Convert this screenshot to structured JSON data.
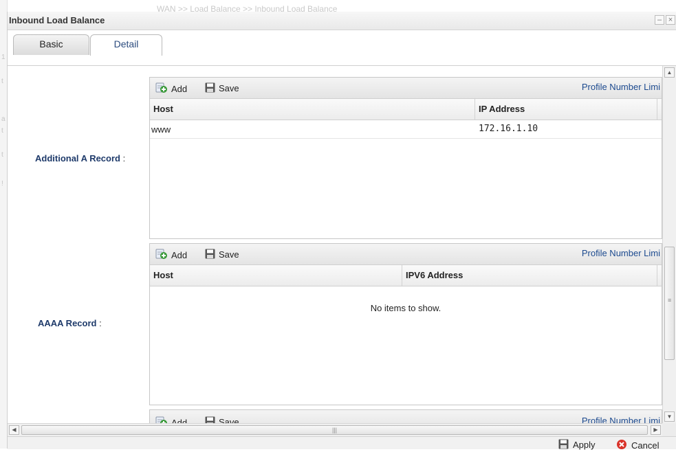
{
  "background": {
    "breadcrumb": "WAN >> Load Balance >> Inbound Load Balance"
  },
  "window": {
    "title": "Inbound Load Balance",
    "minimize_glyph": "–",
    "close_glyph": "×"
  },
  "tabs": [
    {
      "label": "Basic",
      "active": false
    },
    {
      "label": "Detail",
      "active": true
    }
  ],
  "sections": {
    "a_record": {
      "label": "Additional A Record",
      "colon": " :",
      "toolbar": {
        "add_label": "Add",
        "save_label": "Save",
        "limit_link": "Profile Number Limi"
      },
      "columns": [
        "Host",
        "IP Address"
      ],
      "rows": [
        {
          "host": "www",
          "ip": "172.16.1.10"
        }
      ]
    },
    "aaaa_record": {
      "label": "AAAA Record",
      "colon": " :",
      "toolbar": {
        "add_label": "Add",
        "save_label": "Save",
        "limit_link": "Profile Number Limi"
      },
      "columns": [
        "Host",
        "IPV6 Address"
      ],
      "empty_text": "No items to show."
    },
    "third_grid": {
      "toolbar": {
        "add_label": "Add",
        "save_label": "Save",
        "limit_link": "Profile Number Limi"
      }
    }
  },
  "footer": {
    "apply_label": "Apply",
    "cancel_label": "Cancel"
  },
  "colors": {
    "link_blue": "#1c4a8f",
    "label_navy": "#1e3a6a",
    "add_icon_green": "#3a9a3a",
    "cancel_icon_red": "#d9332a"
  },
  "icons": {
    "add": "add-icon",
    "save": "save-icon",
    "apply": "save-icon",
    "cancel": "cancel-icon"
  }
}
